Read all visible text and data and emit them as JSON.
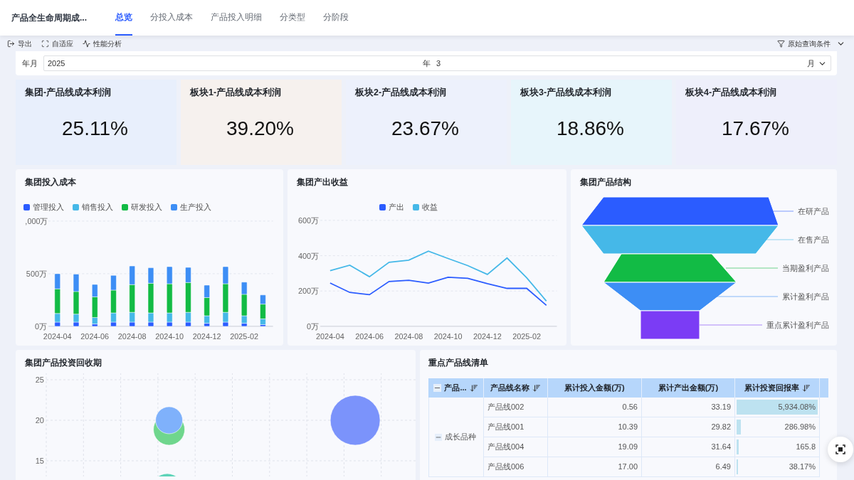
{
  "header": {
    "title": "产品全生命周期成...",
    "tabs": [
      {
        "label": "总览",
        "selected": true
      },
      {
        "label": "分投入成本",
        "selected": false
      },
      {
        "label": "产品投入明细",
        "selected": false
      },
      {
        "label": "分类型",
        "selected": false
      },
      {
        "label": "分阶段",
        "selected": false
      }
    ]
  },
  "toolbar": {
    "actions": [
      {
        "kind": "export",
        "label": "导出"
      },
      {
        "kind": "fit",
        "label": "自适应"
      },
      {
        "kind": "performance",
        "label": "性能分析"
      }
    ],
    "query_conditions": "原始查询条件"
  },
  "filter": {
    "label": "年月",
    "year": "2025",
    "year_unit": "年",
    "month": "3",
    "month_unit": "月"
  },
  "kpis": [
    {
      "title": "集团-产品线成本利润",
      "value": "25.11%",
      "color": "#e8effc"
    },
    {
      "title": "板块1-产品线成本利润",
      "value": "39.20%",
      "color": "#f6f1ee"
    },
    {
      "title": "板块2-产品线成本利润",
      "value": "23.67%",
      "color": "#edf1fc"
    },
    {
      "title": "板块3-产品线成本利润",
      "value": "18.86%",
      "color": "#e7f5fb"
    },
    {
      "title": "板块4-产品线成本利润",
      "value": "17.67%",
      "color": "#eeeffb"
    }
  ],
  "investment_cost": {
    "title": "集团投入成本",
    "cut_axis_label": ",000万",
    "chart_data": {
      "type": "bar",
      "stacked": true,
      "categories": [
        "2024-04",
        null,
        "2024-06",
        null,
        "2024-08",
        null,
        "2024-10",
        null,
        "2024-12",
        null,
        "2025-02",
        null
      ],
      "ylim": [
        0,
        1000
      ],
      "yticks": [
        {
          "value": 0,
          "label": "0万"
        },
        {
          "value": 500,
          "label": "500万"
        }
      ],
      "series": [
        {
          "name": "管理投入",
          "color": "#2b5cff",
          "values": [
            40,
            40,
            22,
            40,
            40,
            40,
            40,
            40,
            29,
            40,
            29,
            16
          ]
        },
        {
          "name": "销售投入",
          "color": "#45b8e8",
          "values": [
            82,
            76,
            62,
            87,
            93,
            87,
            87,
            93,
            71,
            93,
            71,
            55
          ]
        },
        {
          "name": "研发投入",
          "color": "#12bb45",
          "values": [
            234,
            215,
            196,
            217,
            263,
            282,
            277,
            283,
            173,
            271,
            204,
            140
          ]
        },
        {
          "name": "生产投入",
          "color": "#3d8ef5",
          "values": [
            144,
            165,
            118,
            140,
            177,
            147,
            163,
            144,
            118,
            163,
            116,
            87
          ]
        }
      ]
    }
  },
  "output_revenue": {
    "title": "集团产出收益",
    "chart_data": {
      "type": "line",
      "categories": [
        "2024-04",
        null,
        "2024-06",
        null,
        "2024-08",
        null,
        "2024-10",
        null,
        "2024-12",
        null,
        "2025-02",
        null
      ],
      "ylim": [
        0,
        600
      ],
      "yticks": [
        {
          "value": 0,
          "label": "0万"
        },
        {
          "value": 200,
          "label": "200万"
        },
        {
          "value": 400,
          "label": "400万"
        },
        {
          "value": 600,
          "label": "600万"
        }
      ],
      "series": [
        {
          "name": "产出",
          "color": "#2b5cff",
          "values": [
            245,
            192,
            179,
            254,
            261,
            245,
            278,
            272,
            242,
            215,
            215,
            119
          ]
        },
        {
          "name": "收益",
          "color": "#45b8e8",
          "values": [
            315,
            346,
            281,
            363,
            375,
            426,
            384,
            344,
            294,
            387,
            275,
            143
          ]
        }
      ]
    }
  },
  "product_structure": {
    "title": "集团产品结构",
    "stages": [
      {
        "label": "在研产品",
        "color": "#2b5cff"
      },
      {
        "label": "在售产品",
        "color": "#45b8e8"
      },
      {
        "label": "当期盈利产品",
        "color": "#12bb45"
      },
      {
        "label": "累计盈利产品",
        "color": "#3d8ef5"
      },
      {
        "label": "重点累计盈利产品",
        "color": "#7b3cf5"
      }
    ]
  },
  "payback": {
    "title": "集团产品投资回收期",
    "y_axis_labels": [
      "25",
      "20",
      "15"
    ]
  },
  "key_products": {
    "title": "重点产品线清单",
    "columns": [
      {
        "label": "产品...",
        "expanded": true,
        "sortable": true
      },
      {
        "label": "产品线名称",
        "expanded": false,
        "sortable": true
      },
      {
        "label": "累计投入金额(万)",
        "expanded": false,
        "sortable": false
      },
      {
        "label": "累计产出金额(万)",
        "expanded": false,
        "sortable": false
      },
      {
        "label": "累计投资回报率",
        "expanded": false,
        "sortable": true
      }
    ],
    "groups": [
      {
        "label": "成长品种",
        "expanded": true,
        "rows": [
          {
            "name": "产品线002",
            "input": "0.56",
            "output": "33.19",
            "rate": "5,934.08%",
            "level": 1
          },
          {
            "name": "产品线001",
            "input": "10.39",
            "output": "29.82",
            "rate": "286.98%",
            "level": 0.05
          },
          {
            "name": "产品线004",
            "input": "19.09",
            "output": "31.64",
            "rate": "165.8",
            "level": 0.03
          },
          {
            "name": "产品线006",
            "input": "17.00",
            "output": "6.49",
            "rate": "38.17%",
            "level": 0.01
          }
        ]
      }
    ]
  }
}
